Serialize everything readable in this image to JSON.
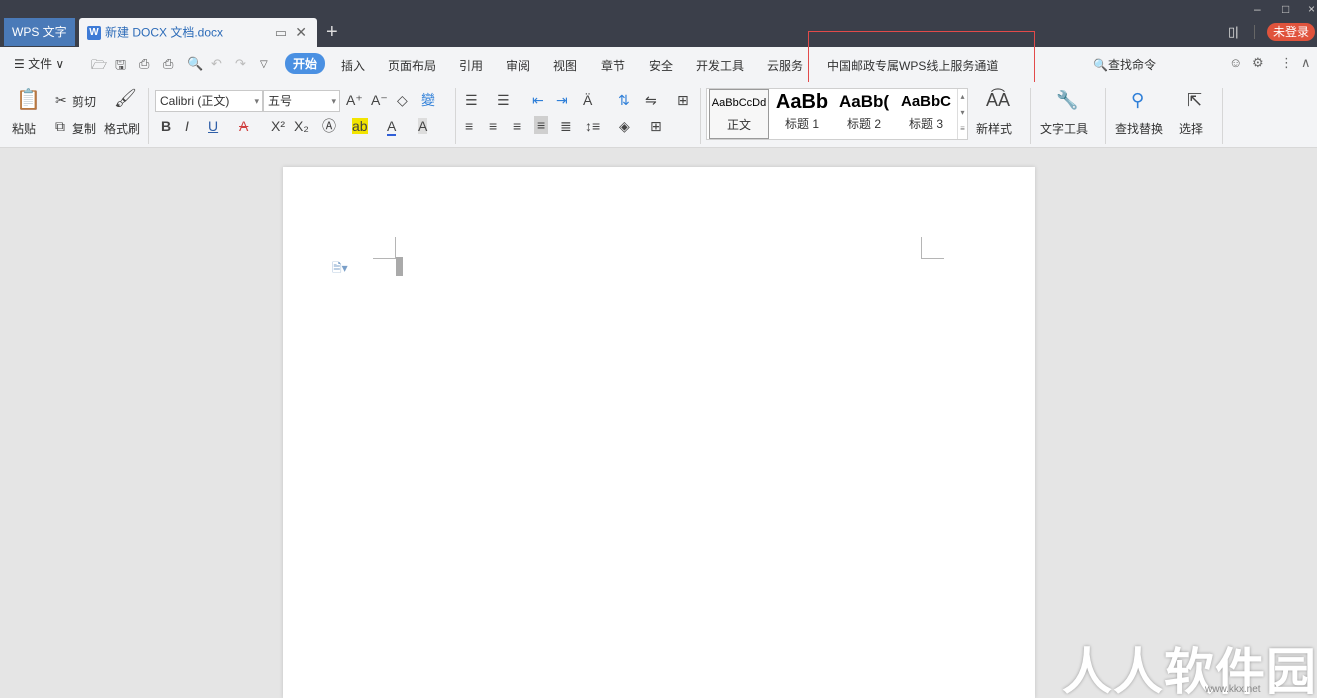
{
  "tabs": {
    "app": "WPS 文字",
    "document": "新建 DOCX 文档.docx",
    "add": "+"
  },
  "window": {
    "login": "未登录"
  },
  "menu": {
    "file": "☰ 文件 ∨",
    "items": [
      "开始",
      "插入",
      "页面布局",
      "引用",
      "审阅",
      "视图",
      "章节",
      "安全",
      "开发工具",
      "云服务",
      "中国邮政专属WPS线上服务通道"
    ],
    "search": "查找命令"
  },
  "ribbon": {
    "paste": "粘贴",
    "cut": "剪切",
    "copy": "复制",
    "format_painter": "格式刷",
    "font_name": "Calibri (正文)",
    "font_size": "五号",
    "styles": [
      {
        "preview": "AaBbCcDd",
        "name": "正文"
      },
      {
        "preview": "AaBb",
        "name": "标题 1"
      },
      {
        "preview": "AaBb(",
        "name": "标题 2"
      },
      {
        "preview": "AaBbC",
        "name": "标题 3"
      }
    ],
    "new_style": "新样式",
    "text_tools": "文字工具",
    "find_replace": "查找替换",
    "select": "选择"
  },
  "watermark": {
    "text": "人人软件园",
    "url": "www.kkx.net"
  },
  "colors": {
    "accent": "#4a90e2",
    "login": "#e0533c",
    "titlebar": "#3b3f4a",
    "highlight": "#e24a4a"
  }
}
